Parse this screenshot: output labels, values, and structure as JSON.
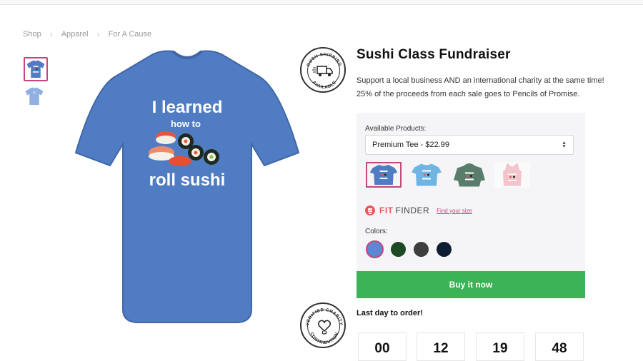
{
  "breadcrumb": [
    "Shop",
    "Apparel",
    "For A Cause"
  ],
  "badges": {
    "shipping": "RUSH SHIPPING AVAILABLE",
    "charity": "VERIFIED CHARITY CONTRIBUTION"
  },
  "shirt": {
    "line1": "I learned",
    "line2": "how to",
    "line3": "roll sushi",
    "color": "#4f7cc3"
  },
  "product": {
    "title": "Sushi Class Fundraiser",
    "description": [
      "Support a local business AND an international charity at the same time!",
      "25% of the proceeds from each sale goes to Pencils of Promise."
    ]
  },
  "options": {
    "available_label": "Available Products:",
    "selected_product": "Premium Tee - $22.99",
    "product_thumbs": [
      {
        "name": "premium-tee",
        "color": "#4f7cc3"
      },
      {
        "name": "light-tee",
        "color": "#6fb4e3"
      },
      {
        "name": "hoodie",
        "color": "#5a7d6b"
      },
      {
        "name": "tank-top",
        "color": "#f4c4cc"
      }
    ],
    "fit_finder_word1": "FIT",
    "fit_finder_word2": "FINDER",
    "fit_link": "Find your size",
    "colors_label": "Colors:",
    "colors": [
      "#5b87d3",
      "#1d4a22",
      "#3e3e3e",
      "#0f1d33"
    ]
  },
  "buy_button": "Buy it now",
  "last_day": "Last day to order!",
  "countdown": [
    "00",
    "12",
    "19",
    "48"
  ]
}
